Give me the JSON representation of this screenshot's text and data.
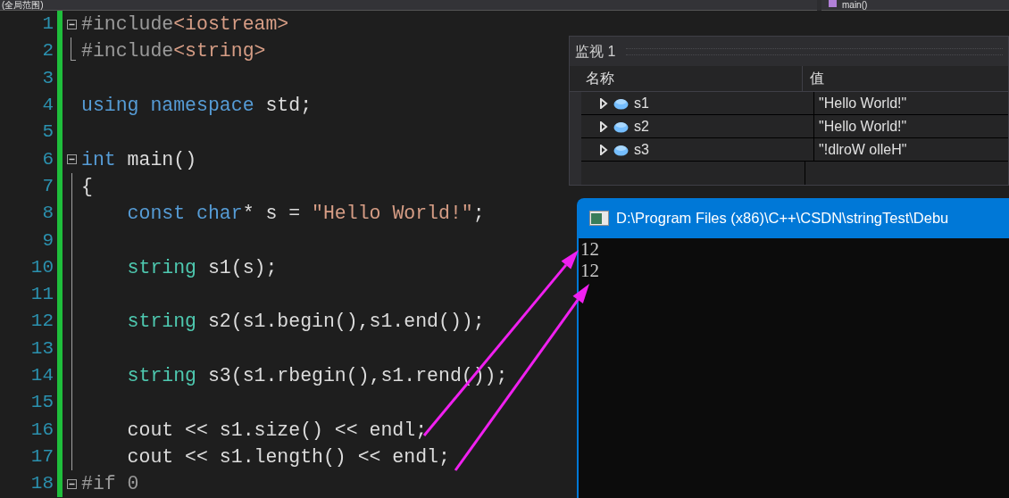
{
  "top_bar": {
    "scope": "(全局范围)",
    "function": "main()"
  },
  "editor": {
    "lines": [
      {
        "number": "1",
        "kind": "collapse",
        "tokens": [
          {
            "text": "#include",
            "kind": "preprocessor"
          },
          {
            "text": "<iostream>",
            "kind": "string"
          }
        ]
      },
      {
        "number": "2",
        "kind": "end",
        "tokens": [
          {
            "text": "#include",
            "kind": "preprocessor"
          },
          {
            "text": "<string>",
            "kind": "string"
          }
        ]
      },
      {
        "number": "3",
        "kind": "plain"
      },
      {
        "number": "4",
        "kind": "plain",
        "tokens": [
          {
            "text": "using namespace",
            "kind": "keyword"
          },
          {
            "text": " std;",
            "kind": "plain"
          }
        ]
      },
      {
        "number": "5",
        "kind": "plain"
      },
      {
        "number": "6",
        "kind": "collapse",
        "tokens": [
          {
            "text": "int",
            "kind": "keyword"
          },
          {
            "text": " main()",
            "kind": "plain"
          }
        ]
      },
      {
        "number": "7",
        "kind": "guide",
        "tokens": [
          {
            "text": "{",
            "kind": "plain"
          }
        ]
      },
      {
        "number": "8",
        "kind": "guide",
        "tokens": [
          {
            "text": "    const char",
            "kind": "keyword"
          },
          {
            "text": "* s = ",
            "kind": "plain"
          },
          {
            "text": "\"Hello World!\"",
            "kind": "string"
          },
          {
            "text": ";",
            "kind": "plain"
          }
        ]
      },
      {
        "number": "9",
        "kind": "guide"
      },
      {
        "number": "10",
        "kind": "guide",
        "tokens": [
          {
            "text": "    string",
            "kind": "type"
          },
          {
            "text": " s1(s);",
            "kind": "plain"
          }
        ]
      },
      {
        "number": "11",
        "kind": "guide"
      },
      {
        "number": "12",
        "kind": "guide",
        "tokens": [
          {
            "text": "    string",
            "kind": "type"
          },
          {
            "text": " s2(s1.begin(),s1.end());",
            "kind": "plain"
          }
        ]
      },
      {
        "number": "13",
        "kind": "guide"
      },
      {
        "number": "14",
        "kind": "guide",
        "tokens": [
          {
            "text": "    string",
            "kind": "type"
          },
          {
            "text": " s3(s1.rbegin(),s1.rend());",
            "kind": "plain"
          }
        ]
      },
      {
        "number": "15",
        "kind": "guide"
      },
      {
        "number": "16",
        "kind": "guide",
        "tokens": [
          {
            "text": "    cout << s1.size() << endl;",
            "kind": "plain"
          }
        ]
      },
      {
        "number": "17",
        "kind": "guide",
        "tokens": [
          {
            "text": "    cout << s1.length() << endl;",
            "kind": "plain"
          }
        ]
      },
      {
        "number": "18",
        "kind": "collapse",
        "tokens": [
          {
            "text": "#if 0",
            "kind": "preprocessor"
          }
        ]
      }
    ]
  },
  "watch": {
    "title": "监视 1",
    "columns": [
      "名称",
      "值"
    ],
    "rows": [
      {
        "name": "s1",
        "value": "\"Hello World!\"",
        "expanded": false
      },
      {
        "name": "s2",
        "value": "\"Hello World!\"",
        "expanded": false
      },
      {
        "name": "s3",
        "value": "\"!dlroW olleH\"",
        "expanded": false
      }
    ]
  },
  "console": {
    "title": "D:\\Program Files (x86)\\C++\\CSDN\\stringTest\\Debu",
    "output": [
      "12",
      "12"
    ]
  }
}
